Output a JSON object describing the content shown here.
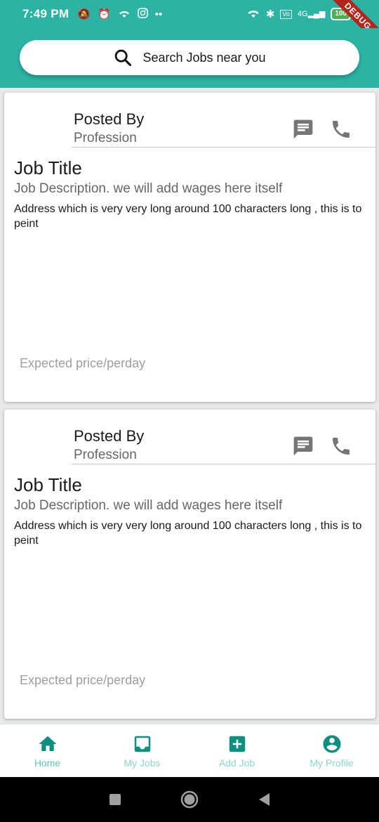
{
  "status_bar": {
    "time": "7:49 PM",
    "battery": "100",
    "debug_label": "DEBUG",
    "icons": [
      "mute-icon",
      "alarm-icon",
      "wifi-icon",
      "instagram-icon",
      "more-dots-icon",
      "wifi-icon",
      "bluetooth-icon",
      "volte-icon",
      "signal-4g-icon",
      "battery-icon"
    ]
  },
  "colors": {
    "primary": "#2bb3a3",
    "icon_grey": "#757575",
    "nav_icon": "#0f8f80"
  },
  "search": {
    "label": "Search Jobs near you",
    "icon": "search-icon"
  },
  "jobs": [
    {
      "posted_by": "Posted By",
      "profession": "Profession",
      "title": "Job Title",
      "description": "Job Description. we will add wages here itself",
      "address": "Address which is very  very long around 100 characters long , this is to peint",
      "price": "Expected price/perday",
      "message_icon": "message-icon",
      "call_icon": "phone-icon"
    },
    {
      "posted_by": "Posted By",
      "profession": "Profession",
      "title": "Job Title",
      "description": "Job Description. we will add wages here itself",
      "address": "Address which is very  very long around 100 characters long , this is to peint",
      "price": "Expected price/perday",
      "message_icon": "message-icon",
      "call_icon": "phone-icon"
    }
  ],
  "bottom_nav": [
    {
      "label": "Home",
      "icon": "home-icon"
    },
    {
      "label": "My Jobs",
      "icon": "inbox-icon"
    },
    {
      "label": "Add Job",
      "icon": "add-box-icon"
    },
    {
      "label": "My Profile",
      "icon": "account-circle-icon"
    }
  ],
  "system_nav": [
    "recents-button",
    "home-button",
    "back-button"
  ]
}
